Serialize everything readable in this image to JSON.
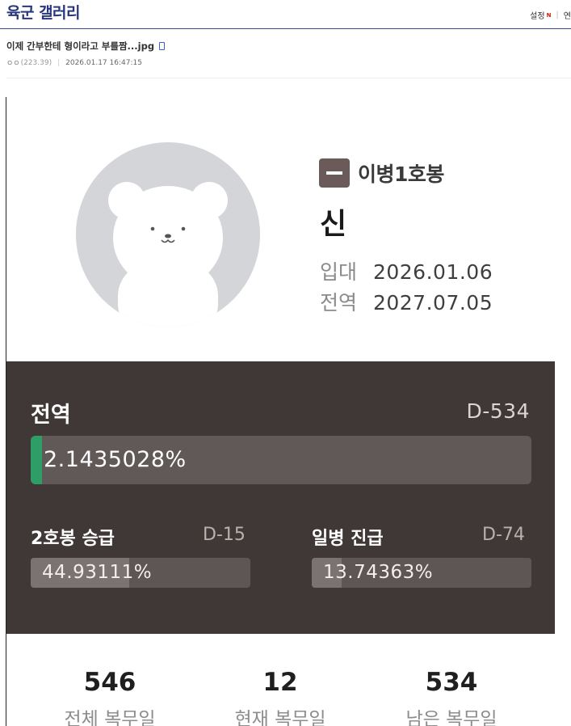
{
  "gallery": {
    "title": "육군 갤러리",
    "settings_label": "설정",
    "new_badge": "N",
    "right_cut_label": "연"
  },
  "post": {
    "title": "이제 간부한테 형이라고 부를짬...jpg",
    "author": "ㅇㅇ",
    "ip": "(223.39)",
    "date": "2026.01.17 16:47:15"
  },
  "profile": {
    "rank": "이병1호봉",
    "name": "신",
    "enlist_label": "입대",
    "enlist_date": "2026.01.06",
    "discharge_label": "전역",
    "discharge_date": "2027.07.05"
  },
  "progress": {
    "discharge": {
      "label": "전역",
      "dday": "D-534",
      "percent_text": "2.1435028%",
      "fraction": 0.021435028
    },
    "promotion_step": {
      "label": "2호봉 승급",
      "dday": "D-15",
      "percent_text": "44.93111%",
      "fraction": 0.4493111
    },
    "promotion_rank": {
      "label": "일병 진급",
      "dday": "D-74",
      "percent_text": "13.74363%",
      "fraction": 0.1374363
    }
  },
  "stats": [
    {
      "value": "546",
      "label": "전체 복무일"
    },
    {
      "value": "12",
      "label": "현재 복무일"
    },
    {
      "value": "534",
      "label": "남은 복무일"
    }
  ],
  "colors": {
    "gallery_accent": "#29367c",
    "panel_bg": "#3f3836",
    "progress_green": "#2f9e66",
    "rank_badge": "#6a5a5a"
  },
  "icons": [
    "mobile-icon",
    "bear-avatar-icon",
    "rank-badge-icon"
  ]
}
